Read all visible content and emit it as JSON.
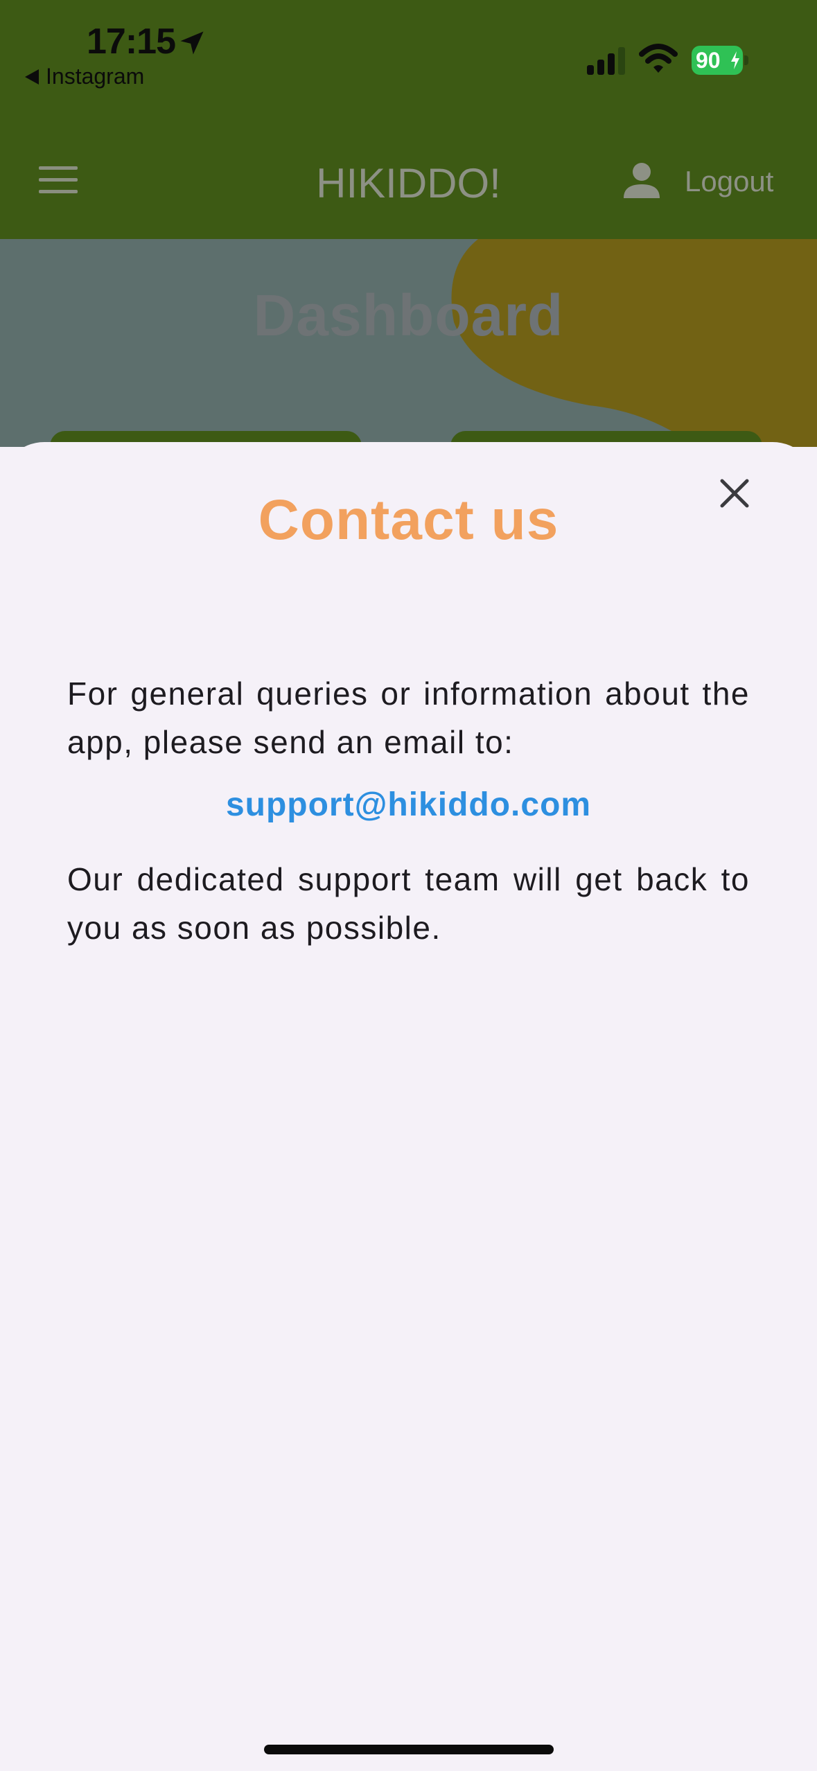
{
  "status_bar": {
    "time": "17:15",
    "back_app": "Instagram",
    "battery": "90"
  },
  "app_bar": {
    "brand": "HIKIDDO!",
    "logout_label": "Logout"
  },
  "dashboard": {
    "title": "Dashboard"
  },
  "contact_sheet": {
    "title": "Contact us",
    "paragraph1": "For general queries or information about the app, please send an email to:",
    "email": "support@hikiddo.com",
    "paragraph2": "Our dedicated support team will get back to you as soon as possible."
  },
  "colors": {
    "status_bg": "#3d5a14",
    "title_accent": "#f2a15e",
    "link": "#2d8fe0",
    "sheet_bg": "#f5f1f8"
  },
  "icons": [
    "location-arrow-icon",
    "back-triangle-icon",
    "cellular-signal-icon",
    "wifi-icon",
    "battery-icon",
    "menu-icon",
    "user-icon",
    "close-icon"
  ]
}
